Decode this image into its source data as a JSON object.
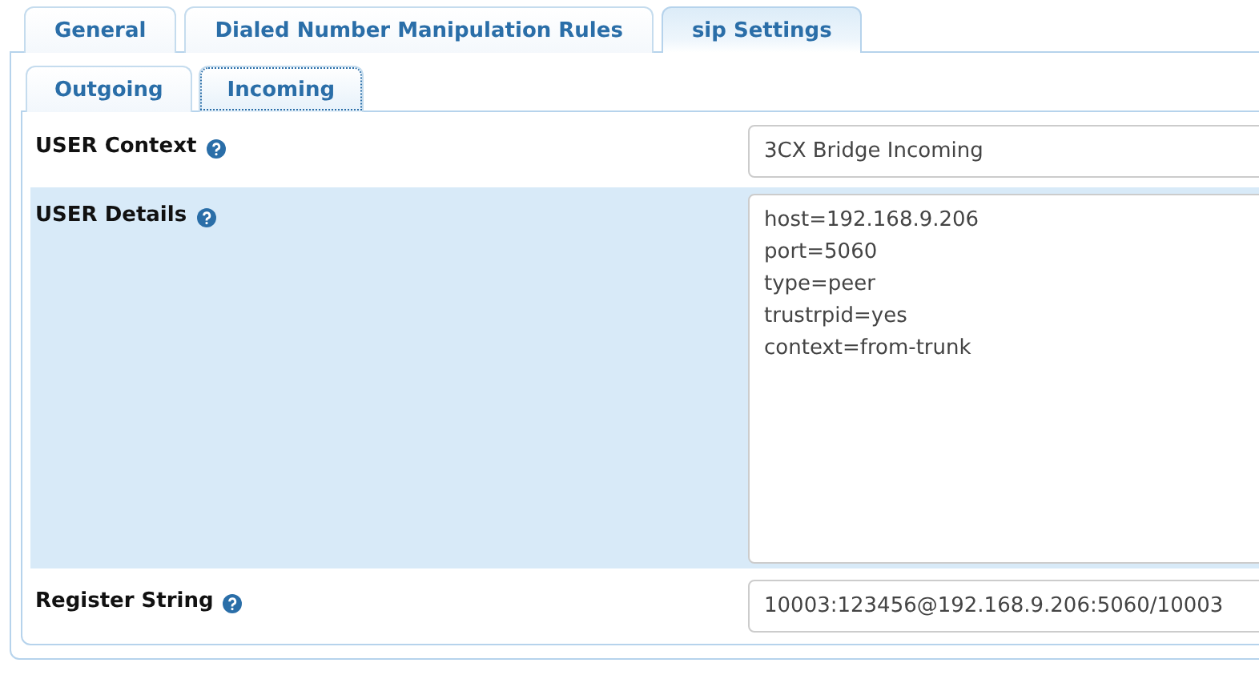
{
  "tabs": [
    {
      "label": "General",
      "selected": false
    },
    {
      "label": "Dialed Number Manipulation Rules",
      "selected": false
    },
    {
      "label": "sip Settings",
      "selected": true
    }
  ],
  "subtabs": [
    {
      "label": "Outgoing",
      "selected": false
    },
    {
      "label": "Incoming",
      "selected": true
    }
  ],
  "rows": [
    {
      "kind": "input",
      "label": "USER Context",
      "value": "3CX Bridge Incoming",
      "highlighted": false
    },
    {
      "kind": "textarea",
      "label": "USER Details",
      "value": "host=192.168.9.206\nport=5060\ntype=peer\ntrustrpid=yes\ncontext=from-trunk",
      "highlighted": true
    },
    {
      "kind": "input",
      "label": "Register String",
      "value": "10003:123456@192.168.9.206:5060/10003",
      "highlighted": false
    }
  ]
}
